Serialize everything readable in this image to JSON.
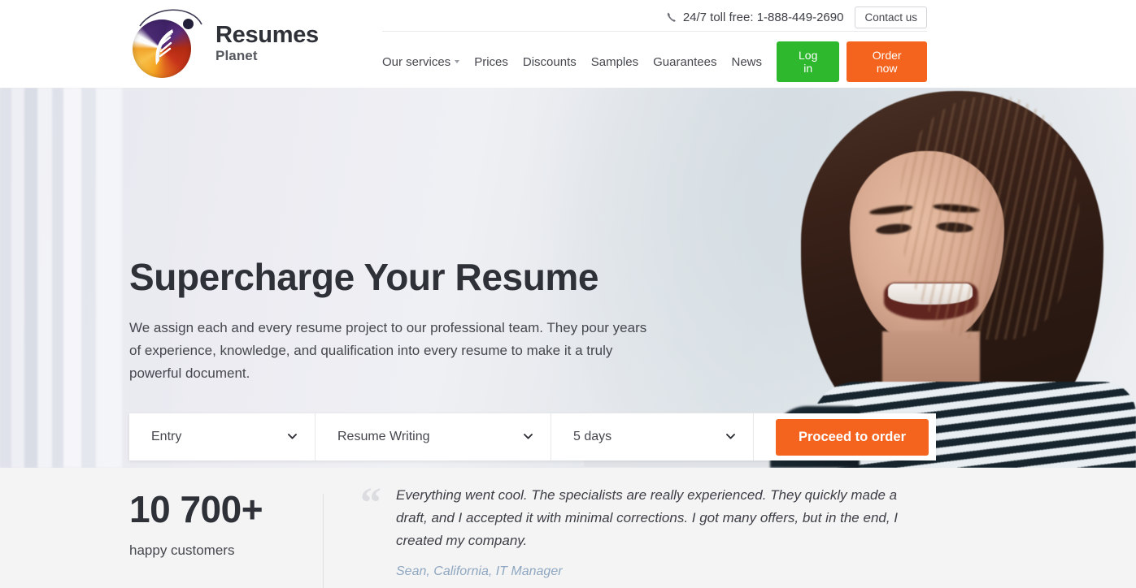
{
  "header": {
    "logo": {
      "word_top": "Resumes",
      "word_bottom": "Planet",
      "icon": "planet-feather-logo"
    },
    "phone_icon": "phone-handset-icon",
    "phone_text": "24/7 toll free: 1-888-449-2690",
    "contact_label": "Contact us",
    "nav": [
      {
        "label": "Our services",
        "has_caret": true
      },
      {
        "label": "Prices",
        "has_caret": false
      },
      {
        "label": "Discounts",
        "has_caret": false
      },
      {
        "label": "Samples",
        "has_caret": false
      },
      {
        "label": "Guarantees",
        "has_caret": false
      },
      {
        "label": "News",
        "has_caret": false
      }
    ],
    "login_label": "Log in",
    "order_label": "Order now"
  },
  "hero": {
    "title": "Supercharge Your Resume",
    "subtitle": "We assign each and every resume project to our professional team. They pour years of experience, knowledge, and qualification into every resume to make it a truly powerful document.",
    "form": {
      "level": {
        "value": "Entry",
        "icon": "chevron-down-icon"
      },
      "service": {
        "value": "Resume Writing",
        "icon": "chevron-down-icon"
      },
      "deadline": {
        "value": "5 days",
        "icon": "chevron-down-icon"
      },
      "proceed_label": "Proceed to order"
    }
  },
  "strip": {
    "stat_number": "10 700+",
    "stat_label": "happy customers",
    "quote_mark": "“",
    "quote_text": "Everything went cool. The specialists are really experienced. They quickly made a draft, and I accepted it with minimal corrections. I got many offers, but in the end, I created my company.",
    "quote_author": "Sean, California, IT Manager"
  },
  "colors": {
    "green": "#2eb82e",
    "orange": "#f4641e",
    "text_dark": "#2e3138",
    "text_body": "#45484e",
    "author_blue": "#8fa7c0",
    "strip_bg": "#f4f4f5"
  }
}
